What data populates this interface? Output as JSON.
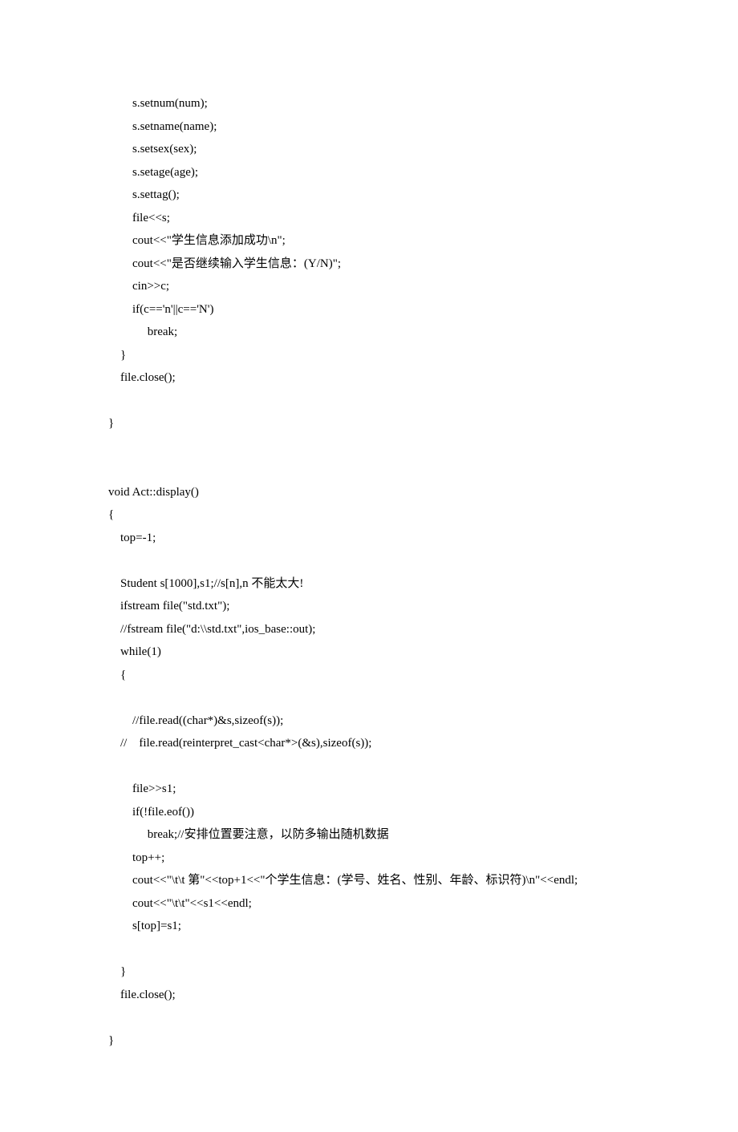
{
  "lines": [
    "        s.setnum(num);",
    "        s.setname(name);",
    "        s.setsex(sex);",
    "        s.setage(age);",
    "        s.settag();",
    "        file<<s;",
    "        cout<<\"学生信息添加成功\\n\";",
    "        cout<<\"是否继续输入学生信息：(Y/N)\";",
    "        cin>>c;",
    "        if(c=='n'||c=='N')",
    "             break;",
    "    }",
    "    file.close();",
    "",
    "}",
    "",
    "",
    "void Act::display()",
    "{",
    "    top=-1;",
    "",
    "    Student s[1000],s1;//s[n],n 不能太大!",
    "    ifstream file(\"std.txt\");",
    "    //fstream file(\"d:\\\\std.txt\",ios_base::out);",
    "    while(1)",
    "    {",
    "",
    "        //file.read((char*)&s,sizeof(s));",
    "    //    file.read(reinterpret_cast<char*>(&s),sizeof(s));",
    "",
    "        file>>s1;",
    "        if(!file.eof())",
    "             break;//安排位置要注意，以防多输出随机数据",
    "        top++;",
    "        cout<<\"\\t\\t 第\"<<top+1<<\"个学生信息：(学号、姓名、性别、年龄、标识符)\\n\"<<endl;",
    "        cout<<\"\\t\\t\"<<s1<<endl;",
    "        s[top]=s1;",
    "",
    "    }",
    "    file.close();",
    "",
    "}"
  ]
}
